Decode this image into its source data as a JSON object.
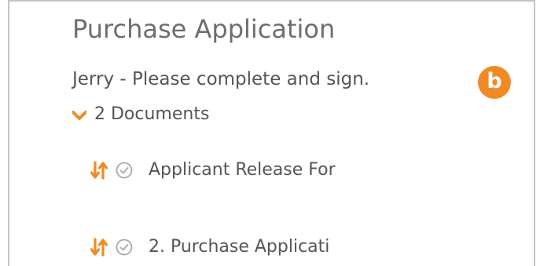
{
  "header": {
    "title": "Purchase Application",
    "subtitle": "Jerry - Please complete and sign.",
    "badge": "b"
  },
  "documents": {
    "toggle_label": "2 Documents",
    "items": [
      {
        "label": "Applicant Release For"
      },
      {
        "label": "2. Purchase Applicati"
      }
    ]
  },
  "colors": {
    "accent": "#f08a24",
    "text": "#555555",
    "title": "#6e6e6e",
    "border": "#c4c4c4"
  },
  "icons": {
    "toggle": "chevron-down-icon",
    "sort": "sort-icon",
    "status": "check-circle-icon"
  }
}
